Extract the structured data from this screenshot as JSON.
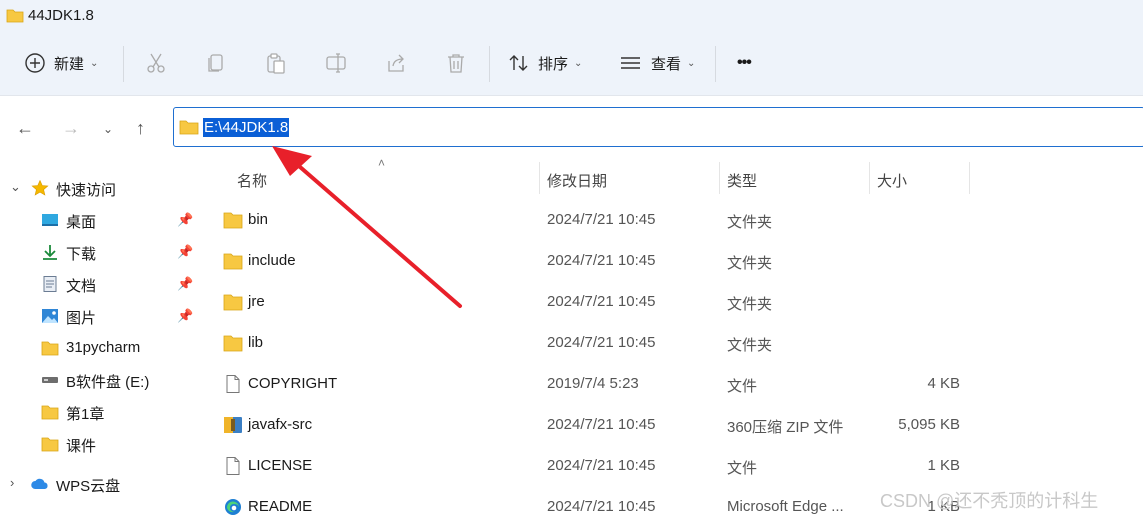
{
  "window": {
    "title": "44JDK1.8"
  },
  "toolbar": {
    "new_label": "新建",
    "sort_label": "排序",
    "view_label": "查看",
    "more_label": "•••"
  },
  "address": {
    "value": "E:\\44JDK1.8"
  },
  "sidebar": {
    "items": [
      {
        "label": "快速访问"
      },
      {
        "label": "桌面"
      },
      {
        "label": "下载"
      },
      {
        "label": "文档"
      },
      {
        "label": "图片"
      },
      {
        "label": "31pycharm"
      },
      {
        "label": "B软件盘 (E:)"
      },
      {
        "label": "第1章"
      },
      {
        "label": "课件"
      },
      {
        "label": "WPS云盘"
      }
    ]
  },
  "columns": {
    "name": "名称",
    "date": "修改日期",
    "type": "类型",
    "size": "大小"
  },
  "files": [
    {
      "name": "bin",
      "date": "2024/7/21 10:45",
      "type": "文件夹",
      "size": ""
    },
    {
      "name": "include",
      "date": "2024/7/21 10:45",
      "type": "文件夹",
      "size": ""
    },
    {
      "name": "jre",
      "date": "2024/7/21 10:45",
      "type": "文件夹",
      "size": ""
    },
    {
      "name": "lib",
      "date": "2024/7/21 10:45",
      "type": "文件夹",
      "size": ""
    },
    {
      "name": "COPYRIGHT",
      "date": "2019/7/4 5:23",
      "type": "文件",
      "size": "4 KB"
    },
    {
      "name": "javafx-src",
      "date": "2024/7/21 10:45",
      "type": "360压缩 ZIP 文件",
      "size": "5,095 KB"
    },
    {
      "name": "LICENSE",
      "date": "2024/7/21 10:45",
      "type": "文件",
      "size": "1 KB"
    },
    {
      "name": "README",
      "date": "2024/7/21 10:45",
      "type": "Microsoft Edge ...",
      "size": "1 KB"
    }
  ],
  "watermark": "CSDN @还不秃顶的计科生",
  "colors": {
    "accent": "#1f6fd0",
    "selection": "#0b5fd6",
    "folder": "#f7c842",
    "annotation_arrow": "#e8202a"
  }
}
